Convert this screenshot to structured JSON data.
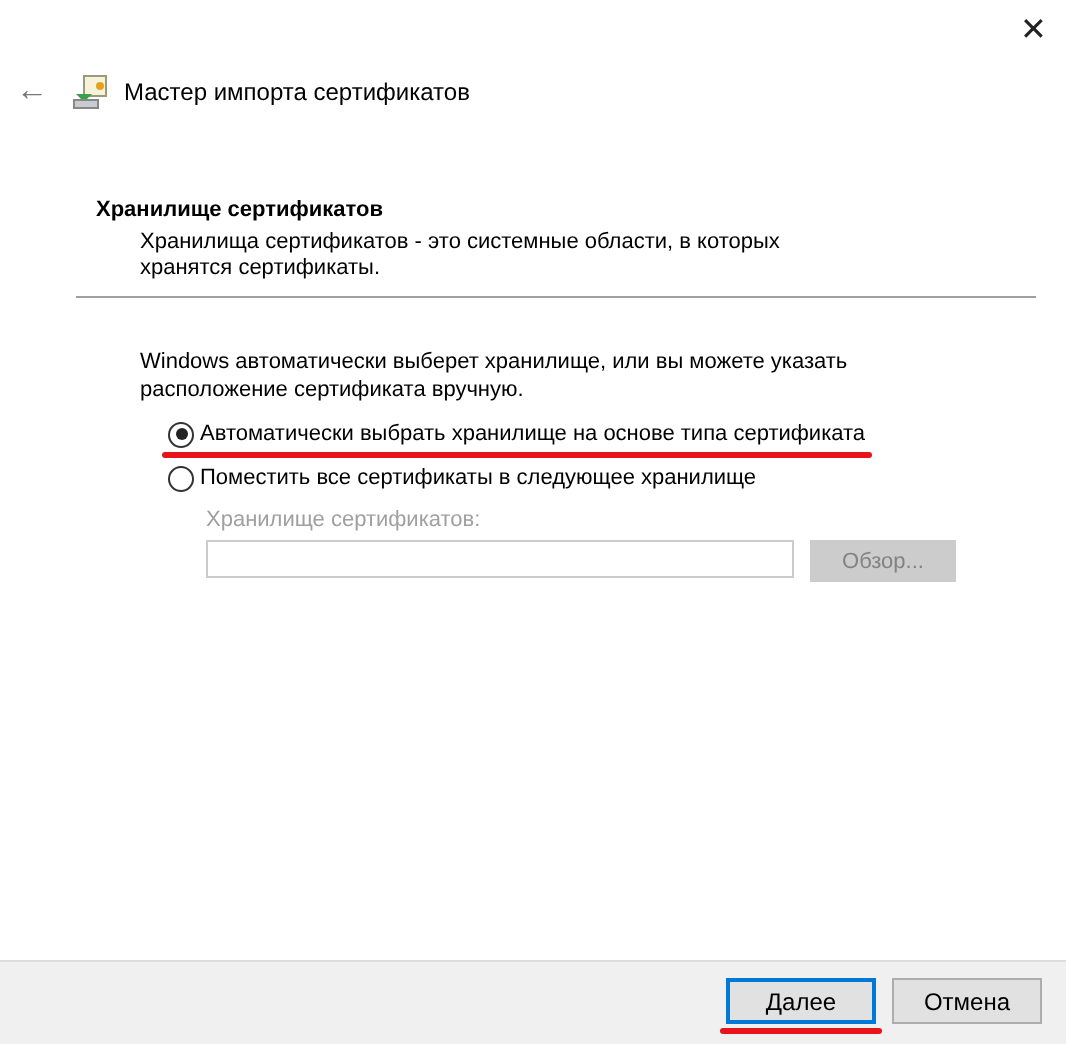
{
  "window": {
    "title": "Мастер импорта сертификатов",
    "close": "✕",
    "back": "←"
  },
  "section": {
    "title": "Хранилище сертификатов",
    "description": "Хранилища сертификатов - это системные области, в которых хранятся сертификаты."
  },
  "intro": "Windows автоматически выберет хранилище, или вы можете указать расположение сертификата вручную.",
  "options": [
    {
      "label": "Автоматически выбрать хранилище на основе типа сертификата",
      "selected": true,
      "marked": true
    },
    {
      "label": "Поместить все сертификаты в следующее хранилище",
      "selected": false,
      "marked": false
    }
  ],
  "store_field": {
    "label": "Хранилище сертификатов:",
    "disabled": true,
    "browse": "Обзор..."
  },
  "buttons": [
    {
      "label": "Далее",
      "default": true,
      "marked": true
    },
    {
      "label": "Отмена",
      "default": false,
      "marked": false
    }
  ]
}
